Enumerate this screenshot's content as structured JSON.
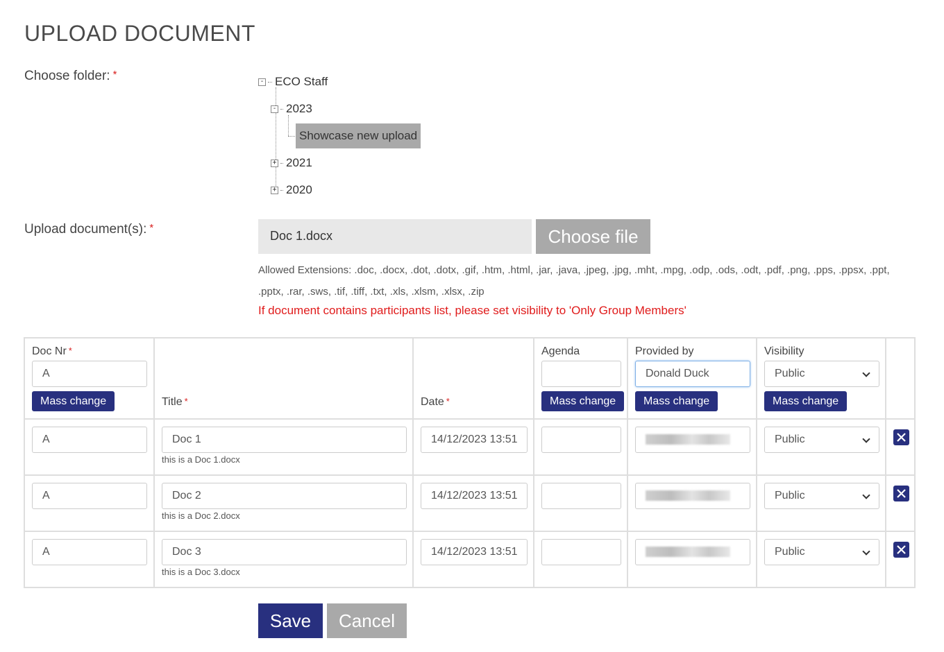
{
  "page": {
    "title": "UPLOAD DOCUMENT"
  },
  "folder": {
    "label": "Choose folder:",
    "required": "*",
    "tree": {
      "root": {
        "label": "ECO Staff",
        "toggle": "-"
      },
      "year_2023": {
        "label": "2023",
        "toggle": "-"
      },
      "selected_child": {
        "label": "Showcase new upload"
      },
      "year_2021": {
        "label": "2021",
        "toggle": "+"
      },
      "year_2020": {
        "label": "2020",
        "toggle": "+"
      }
    }
  },
  "upload": {
    "label": "Upload document(s):",
    "required": "*",
    "file_name": "Doc 1.docx",
    "choose_label": "Choose file",
    "allowed_extensions": "Allowed Extensions: .doc, .docx, .dot, .dotx, .gif, .htm, .html, .jar, .java, .jpeg, .jpg, .mht, .mpg, .odp, .ods, .odt, .pdf, .png, .pps, .ppsx, .ppt, .pptx, .rar, .sws, .tif, .tiff, .txt, .xls, .xlsm, .xlsx, .zip",
    "warning": "If document contains participants list, please set visibility to 'Only Group Members'"
  },
  "table": {
    "required": "*",
    "headers": {
      "doc_nr": "Doc Nr",
      "title": "Title",
      "date": "Date",
      "agenda": "Agenda",
      "provided_by": "Provided by",
      "visibility": "Visibility"
    },
    "mass": {
      "doc_nr_value": "A",
      "agenda_value": "",
      "provided_by_value": "Donald Duck",
      "visibility_value": "Public",
      "button_label": "Mass change"
    },
    "rows": [
      {
        "doc_nr": "A",
        "title": "Doc 1",
        "subtitle": "this is a Doc 1.docx",
        "date": "14/12/2023 13:51",
        "agenda": "",
        "provided_by": "",
        "visibility": "Public"
      },
      {
        "doc_nr": "A",
        "title": "Doc 2",
        "subtitle": "this is a Doc 2.docx",
        "date": "14/12/2023 13:51",
        "agenda": "",
        "provided_by": "",
        "visibility": "Public"
      },
      {
        "doc_nr": "A",
        "title": "Doc 3",
        "subtitle": "this is a Doc 3.docx",
        "date": "14/12/2023 13:51",
        "agenda": "",
        "provided_by": "",
        "visibility": "Public"
      }
    ]
  },
  "actions": {
    "save_label": "Save",
    "cancel_label": "Cancel"
  },
  "colors": {
    "primary": "#28307f",
    "secondary": "#a9a9a9",
    "warning": "#e01b1b",
    "required": "#d9201f"
  },
  "icons": {
    "delete": "close-icon",
    "expand": "plus-box-icon",
    "collapse": "minus-box-icon"
  }
}
